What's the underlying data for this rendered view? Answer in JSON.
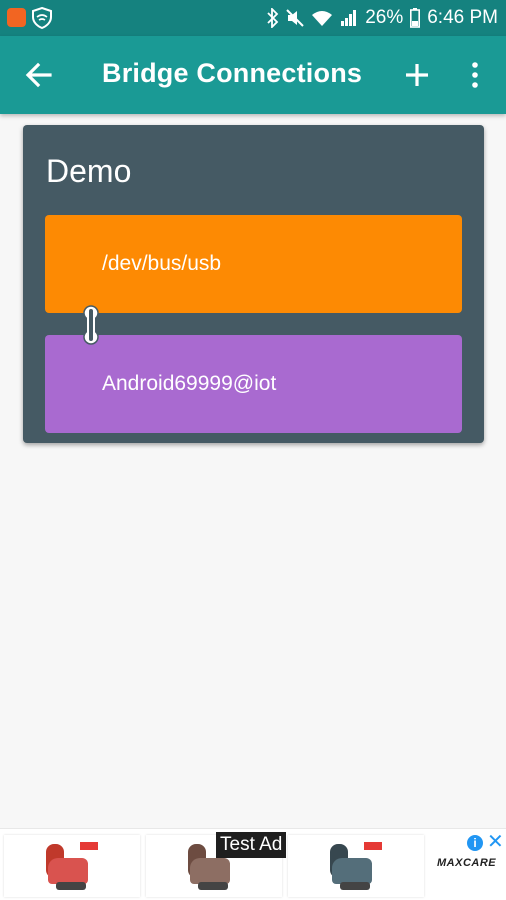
{
  "status_bar": {
    "battery": "26%",
    "time": "6:46 PM",
    "icons": [
      "app-notification-icon",
      "shield-wifi-icon",
      "bluetooth-icon",
      "mute-icon",
      "wifi-icon",
      "signal-icon",
      "battery-icon"
    ]
  },
  "app_bar": {
    "title": "Bridge Connections",
    "back_icon": "arrow-left-icon",
    "add_icon": "plus-icon",
    "menu_icon": "more-vertical-icon",
    "color": "#1a9a95"
  },
  "bridge": {
    "name": "Demo",
    "source": "/dev/bus/usb",
    "target": "Android69999@iot",
    "colors": {
      "card": "#455a64",
      "source": "#fd8a03",
      "target": "#a96ad0"
    }
  },
  "ad": {
    "label": "Test Ad",
    "brand": "MAXCARE",
    "info_icon": "info-icon",
    "close_icon": "close-icon"
  }
}
